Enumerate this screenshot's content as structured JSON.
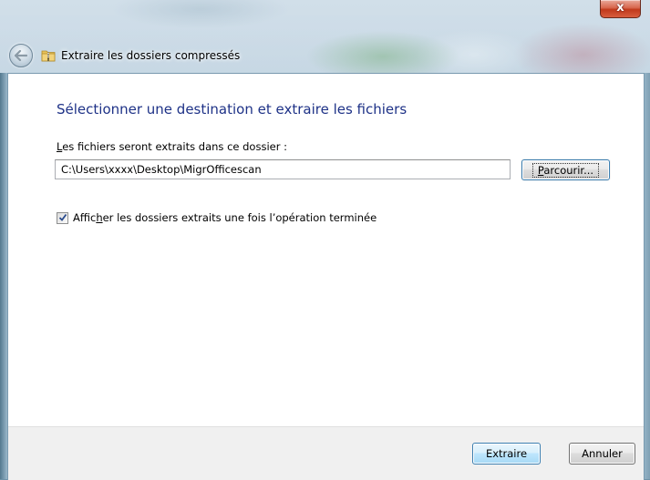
{
  "window": {
    "title": "Extraire les dossiers compressés",
    "close_label": "x"
  },
  "main": {
    "heading": "Sélectionner une destination et extraire les fichiers",
    "destination_label_accel": "L",
    "destination_label_rest": "es fichiers seront extraits dans ce dossier :",
    "destination_value": "C:\\Users\\xxxx\\Desktop\\MigrOfficescan",
    "browse_accel": "P",
    "browse_rest": "arcourir...",
    "checkbox_label_pre": "Affic",
    "checkbox_label_accel": "h",
    "checkbox_label_post": "er les dossiers extraits une fois l’opération terminée",
    "checkbox_checked": true
  },
  "footer": {
    "extract_label": "Extraire",
    "cancel_label": "Annuler"
  },
  "colors": {
    "heading": "#1e3287",
    "default_button_border": "#3c7fb1",
    "close_button": "#c03a1c"
  }
}
